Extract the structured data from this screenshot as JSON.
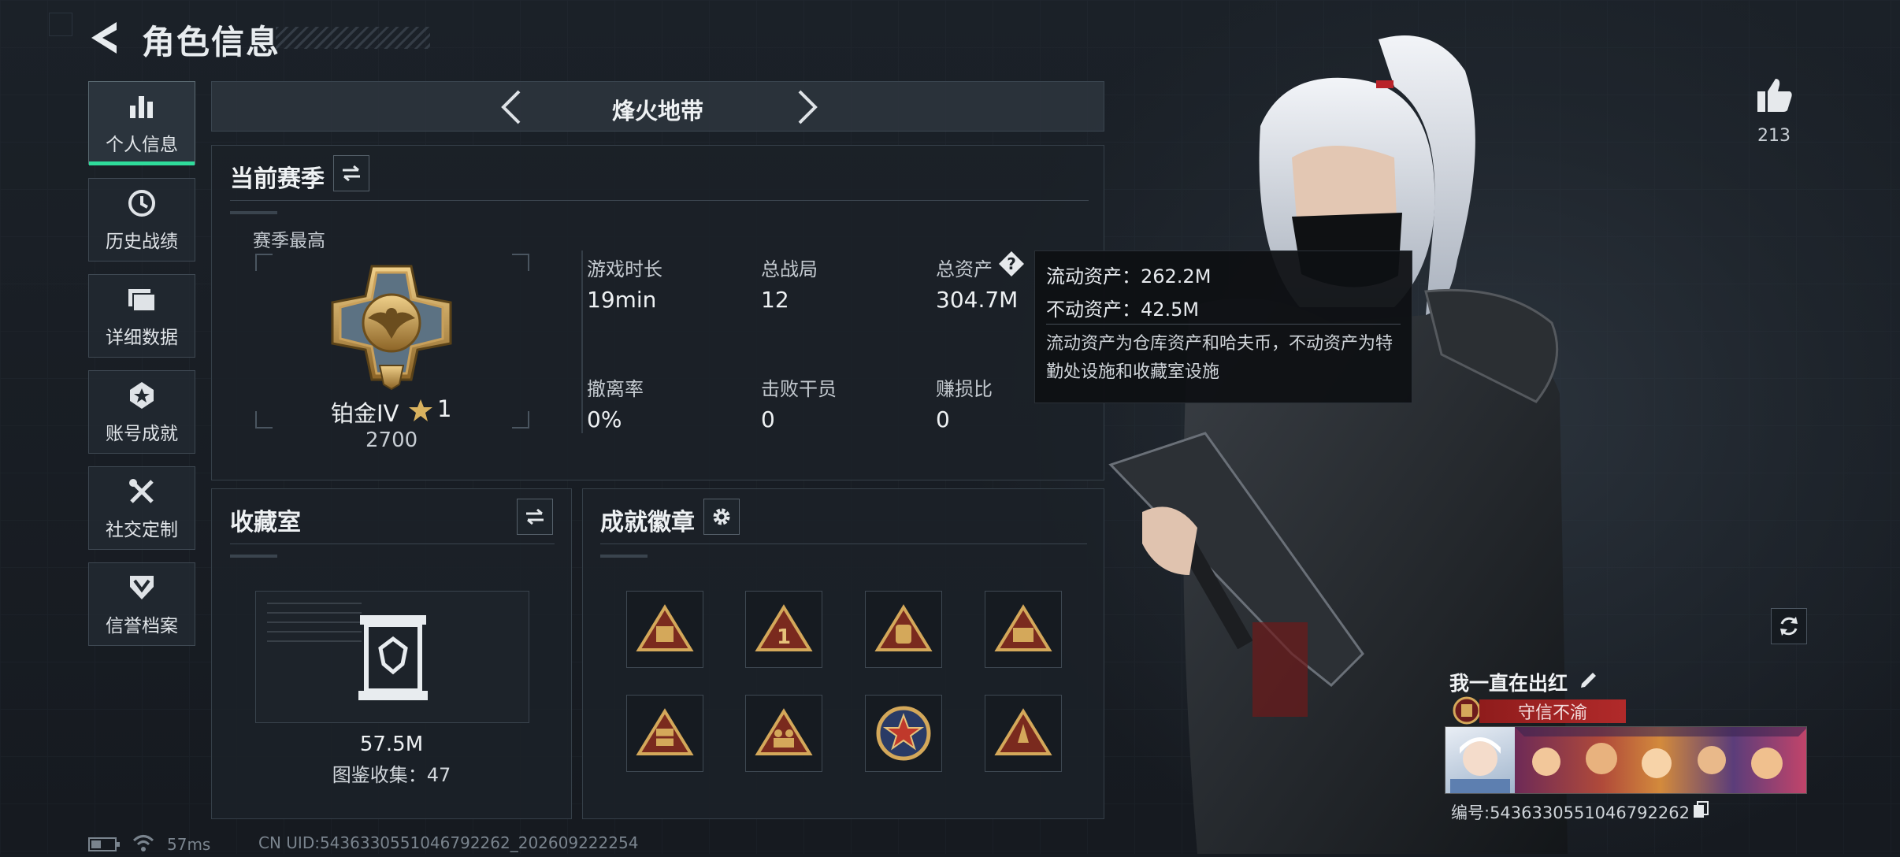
{
  "header": {
    "title": "角色信息"
  },
  "sidebar": {
    "items": [
      {
        "label": "个人信息",
        "icon": "bar-chart-icon",
        "active": true
      },
      {
        "label": "历史战绩",
        "icon": "history-clock-icon"
      },
      {
        "label": "详细数据",
        "icon": "folder-icon"
      },
      {
        "label": "账号成就",
        "icon": "achievement-icon"
      },
      {
        "label": "社交定制",
        "icon": "tools-icon"
      },
      {
        "label": "信誉档案",
        "icon": "shield-chevron-icon"
      }
    ]
  },
  "mode_selector": {
    "current": "烽火地带"
  },
  "season": {
    "title": "当前赛季",
    "peak_label": "赛季最高",
    "rank_name": "铂金IV",
    "rank_stars": "1",
    "rank_score": "2700",
    "stats": [
      {
        "label": "游戏时长",
        "value": "19min"
      },
      {
        "label": "总战局",
        "value": "12"
      },
      {
        "label": "总资产",
        "value": "304.7M"
      },
      {
        "label": "撤离率",
        "value": "0%"
      },
      {
        "label": "击败干员",
        "value": "0"
      },
      {
        "label": "赚损比",
        "value": "0"
      }
    ]
  },
  "tooltip": {
    "liquid": "流动资产：262.2M",
    "fixed": "不动资产：42.5M",
    "description": "流动资产为仓库资产和哈夫币，不动资产为特勤处设施和收藏室设施"
  },
  "collection": {
    "title": "收藏室",
    "value": "57.5M",
    "count_text": "图鉴收集：47"
  },
  "badges": {
    "title": "成就徽章"
  },
  "profile": {
    "likes": "213",
    "player_name": "我一直在出红",
    "title_badge": "守信不渝",
    "player_id": "编号:5436330551046792262"
  },
  "footer": {
    "ping": "57ms",
    "uid": "CN UID:5436330551046792262_202609222254"
  },
  "colors": {
    "accent_green": "#2fdc9b",
    "title_red": "#b12a2a",
    "gold": "#c9a05a"
  }
}
